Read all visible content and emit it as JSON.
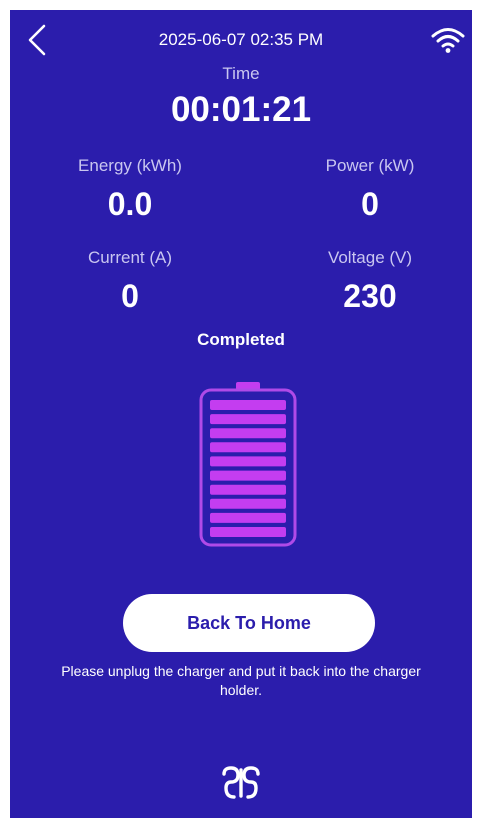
{
  "header": {
    "datetime": "2025-06-07 02:35 PM",
    "back_icon": "chevron-left-icon",
    "wifi_icon": "wifi-icon"
  },
  "time": {
    "label": "Time",
    "value": "00:01:21"
  },
  "stats": {
    "energy": {
      "label": "Energy (kWh)",
      "value": "0.0"
    },
    "power": {
      "label": "Power (kW)",
      "value": "0"
    },
    "current": {
      "label": "Current (A)",
      "value": "0"
    },
    "voltage": {
      "label": "Voltage (V)",
      "value": "230"
    }
  },
  "status": "Completed",
  "battery": {
    "icon": "battery-full-icon",
    "level_fraction": 1.0
  },
  "actions": {
    "back_home_label": "Back To Home"
  },
  "note": "Please unplug the charger and put it back into the charger holder.",
  "colors": {
    "background": "#2b1dac",
    "label": "#c9c6f0",
    "battery_fill": "#c43df0",
    "button_text": "#2b1dac"
  },
  "logo_icon": "brand-logo-icon"
}
